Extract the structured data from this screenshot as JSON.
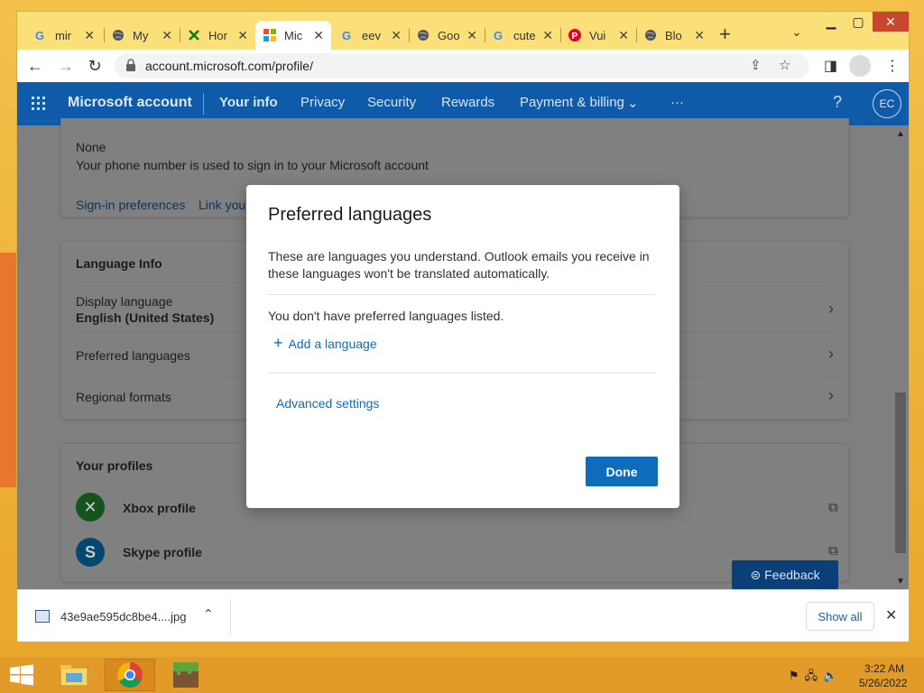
{
  "browser": {
    "tabs": [
      {
        "label": "mir",
        "icon": "google-icon"
      },
      {
        "label": "My",
        "icon": "globe-icon"
      },
      {
        "label": "Hor",
        "icon": "xbox-icon"
      },
      {
        "label": "Mic",
        "icon": "microsoft-icon",
        "active": true
      },
      {
        "label": "eev",
        "icon": "google-icon"
      },
      {
        "label": "Goo",
        "icon": "globe-icon"
      },
      {
        "label": "cute",
        "icon": "google-icon"
      },
      {
        "label": "Vui",
        "icon": "pinterest-icon"
      },
      {
        "label": "Blo",
        "icon": "globe-icon"
      }
    ],
    "url": "account.microsoft.com/profile/"
  },
  "header": {
    "brand": "Microsoft account",
    "nav": [
      "Your info",
      "Privacy",
      "Security",
      "Rewards",
      "Payment & billing"
    ],
    "more": "···",
    "help": "?",
    "avatar_initials": "EC"
  },
  "phone_card": {
    "value": "None",
    "description": "Your phone number is used to sign in to your Microsoft account",
    "link1": "Sign-in preferences",
    "link2": "Link your"
  },
  "language_card": {
    "title": "Language Info",
    "display_label": "Display language",
    "display_value": "English (United States)",
    "preferred": "Preferred languages",
    "regional": "Regional formats"
  },
  "profiles_card": {
    "title": "Your profiles",
    "xbox": "Xbox profile",
    "skype": "Skype profile"
  },
  "feedback": "Feedback",
  "modal": {
    "title": "Preferred languages",
    "description": "These are languages you understand. Outlook emails you receive in these languages won't be translated automatically.",
    "empty": "You don't have preferred languages listed.",
    "add": "Add a language",
    "advanced": "Advanced settings",
    "done": "Done"
  },
  "downloads": {
    "file": "43e9ae595dc8be4....jpg",
    "show_all": "Show all"
  },
  "taskbar": {
    "time": "3:22 AM",
    "date": "5/26/2022"
  },
  "colors": {
    "accent": "#0f6cbd",
    "header": "#0f5ba9",
    "taskbar": "#e29a28"
  }
}
